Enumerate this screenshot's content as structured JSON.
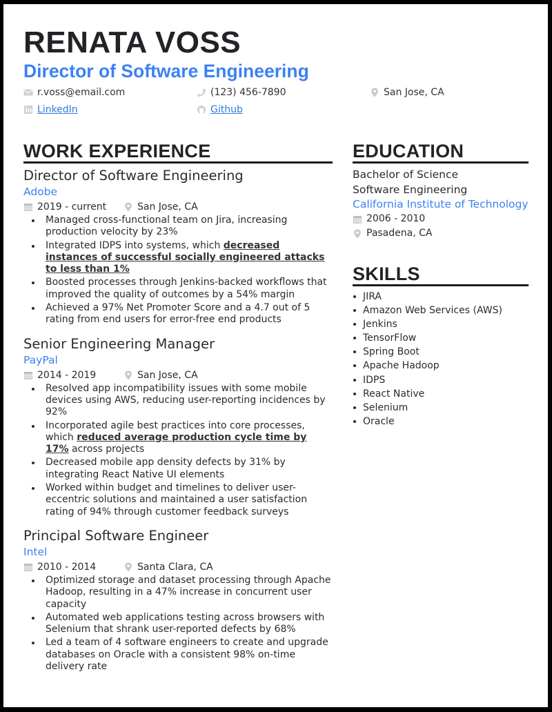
{
  "header": {
    "name": "RENATA VOSS",
    "title": "Director of Software Engineering",
    "contacts": {
      "email": {
        "icon": "envelope-icon",
        "text": "r.voss@email.com"
      },
      "phone": {
        "icon": "phone-icon",
        "text": "(123) 456-7890"
      },
      "location": {
        "icon": "map-pin-icon",
        "text": "San Jose, CA"
      },
      "linkedin": {
        "icon": "linkedin-icon",
        "text": "LinkedIn"
      },
      "github": {
        "icon": "github-icon",
        "text": "Github"
      }
    }
  },
  "colors": {
    "accent": "#3b82f1",
    "heading": "#222326",
    "icon_gray": "#c8c8c8"
  },
  "work": {
    "heading": "WORK EXPERIENCE",
    "jobs": [
      {
        "title": "Director of Software Engineering",
        "company": "Adobe",
        "dates": "2019 - current",
        "location": "San Jose, CA",
        "bullets": [
          {
            "pre": "Managed cross-functional team on Jira, increasing production velocity by 23%",
            "hl": "",
            "post": ""
          },
          {
            "pre": "Integrated IDPS into systems, which ",
            "hl": "decreased instances of successful socially engineered attacks to less than 1%",
            "post": ""
          },
          {
            "pre": "Boosted processes through Jenkins-backed workflows that improved the quality of outcomes by a 54% margin",
            "hl": "",
            "post": ""
          },
          {
            "pre": "Achieved a 97% Net Promoter Score and a 4.7 out of 5 rating from end users for error-free end products",
            "hl": "",
            "post": ""
          }
        ]
      },
      {
        "title": "Senior Engineering Manager",
        "company": "PayPal",
        "dates": "2014 - 2019",
        "location": "San Jose, CA",
        "bullets": [
          {
            "pre": "Resolved app incompatibility issues with some mobile devices using AWS, reducing user-reporting incidences by 92%",
            "hl": "",
            "post": ""
          },
          {
            "pre": "Incorporated agile best practices into core processes, which ",
            "hl": "reduced average production cycle time by 17%",
            "post": " across projects"
          },
          {
            "pre": "Decreased mobile app density defects by 31% by integrating React Native UI elements",
            "hl": "",
            "post": ""
          },
          {
            "pre": "Worked within budget and timelines to deliver user-eccentric solutions and maintained a user satisfaction rating of 94% through customer feedback surveys",
            "hl": "",
            "post": ""
          }
        ]
      },
      {
        "title": "Principal Software Engineer",
        "company": "Intel",
        "dates": "2010 - 2014",
        "location": "Santa Clara, CA",
        "bullets": [
          {
            "pre": "Optimized storage and dataset processing through Apache Hadoop, resulting in a 47% increase in concurrent user capacity",
            "hl": "",
            "post": ""
          },
          {
            "pre": "Automated web applications testing across browsers with Selenium that shrank user-reported defects by 68%",
            "hl": "",
            "post": ""
          },
          {
            "pre": "Led a team of 4 software engineers to create and upgrade databases on Oracle with a consistent 98% on-time delivery rate",
            "hl": "",
            "post": ""
          }
        ]
      }
    ]
  },
  "education": {
    "heading": "EDUCATION",
    "degree": "Bachelor of Science",
    "field": "Software Engineering",
    "school": "California Institute of Technology",
    "dates": "2006 - 2010",
    "location": "Pasadena, CA"
  },
  "skills": {
    "heading": "SKILLS",
    "items": [
      "JIRA",
      "Amazon Web Services (AWS)",
      "Jenkins",
      "TensorFlow",
      "Spring Boot",
      "Apache Hadoop",
      "IDPS",
      "React Native",
      "Selenium",
      "Oracle"
    ]
  }
}
